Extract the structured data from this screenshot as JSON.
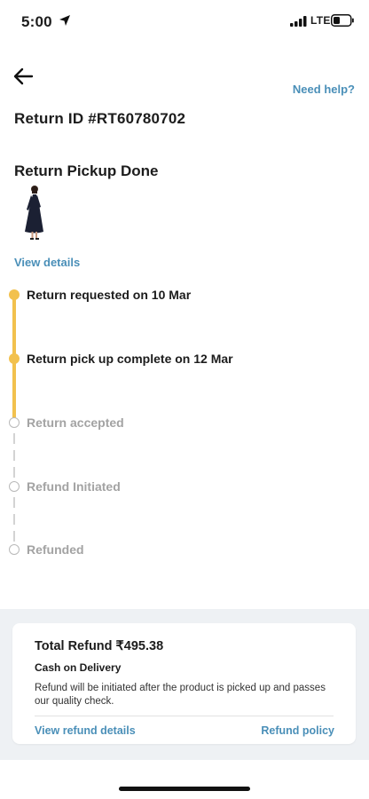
{
  "status_bar": {
    "time": "5:00",
    "network": "LTE",
    "icons": [
      "location-arrow-icon",
      "signal-bars-icon",
      "battery-icon"
    ]
  },
  "header": {
    "back_icon": "arrow-left-icon",
    "help_label": "Need help?"
  },
  "return": {
    "id_text": "Return ID #RT60780702",
    "status_title": "Return Pickup Done",
    "view_details_label": "View details"
  },
  "timeline": {
    "steps": [
      {
        "label": "Return requested on 10 Mar",
        "done": true
      },
      {
        "label": "Return pick up complete on 12 Mar",
        "done": true
      },
      {
        "label": "Return accepted",
        "done": false
      },
      {
        "label": "Refund Initiated",
        "done": false
      },
      {
        "label": "Refunded",
        "done": false
      }
    ]
  },
  "refund": {
    "total_label": "Total Refund ₹495.38",
    "method": "Cash on Delivery",
    "note": "Refund will be initiated after the product is picked up and passes our quality check.",
    "view_refund_label": "View refund details",
    "policy_label": "Refund policy"
  },
  "colors": {
    "accent": "#4a8fb8",
    "timeline_done": "#f2c14e",
    "timeline_pending": "#b9b9b9",
    "section_bg": "#eef1f4"
  }
}
